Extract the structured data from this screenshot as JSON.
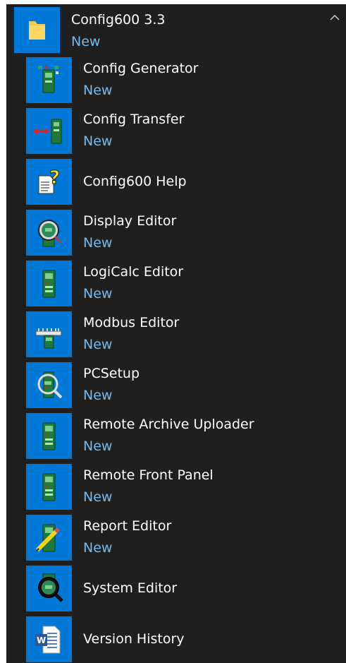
{
  "group": {
    "title": "Config600 3.3",
    "badge": "New",
    "icon": "folder-icon",
    "collapse_icon": "chevron-up-icon"
  },
  "colors": {
    "background": "#1f1f1f",
    "tile": "#0078d7",
    "new_text": "#76b9ed",
    "text": "#ffffff"
  },
  "items": [
    {
      "label": "Config Generator",
      "badge": "New",
      "icon": "config-generator-icon"
    },
    {
      "label": "Config Transfer",
      "badge": "New",
      "icon": "config-transfer-icon"
    },
    {
      "label": "Config600 Help",
      "badge": "",
      "icon": "help-file-icon"
    },
    {
      "label": "Display Editor",
      "badge": "New",
      "icon": "display-editor-icon"
    },
    {
      "label": "LogiCalc Editor",
      "badge": "New",
      "icon": "logicalc-editor-icon"
    },
    {
      "label": "Modbus Editor",
      "badge": "New",
      "icon": "modbus-editor-icon"
    },
    {
      "label": "PCSetup",
      "badge": "New",
      "icon": "pcsetup-icon"
    },
    {
      "label": "Remote Archive Uploader",
      "badge": "New",
      "icon": "remote-archive-uploader-icon"
    },
    {
      "label": "Remote Front Panel",
      "badge": "New",
      "icon": "remote-front-panel-icon"
    },
    {
      "label": "Report Editor",
      "badge": "New",
      "icon": "report-editor-icon"
    },
    {
      "label": "System Editor",
      "badge": "",
      "icon": "system-editor-icon"
    },
    {
      "label": "Version History",
      "badge": "",
      "icon": "word-document-icon"
    }
  ]
}
